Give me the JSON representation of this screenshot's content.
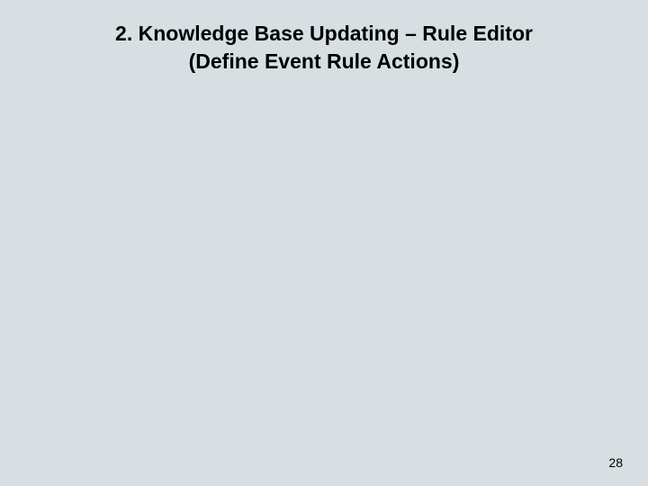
{
  "slide": {
    "title_line1": "2. Knowledge Base Updating – Rule Editor",
    "title_line2": "(Define Event Rule Actions)",
    "page_number": "28"
  }
}
